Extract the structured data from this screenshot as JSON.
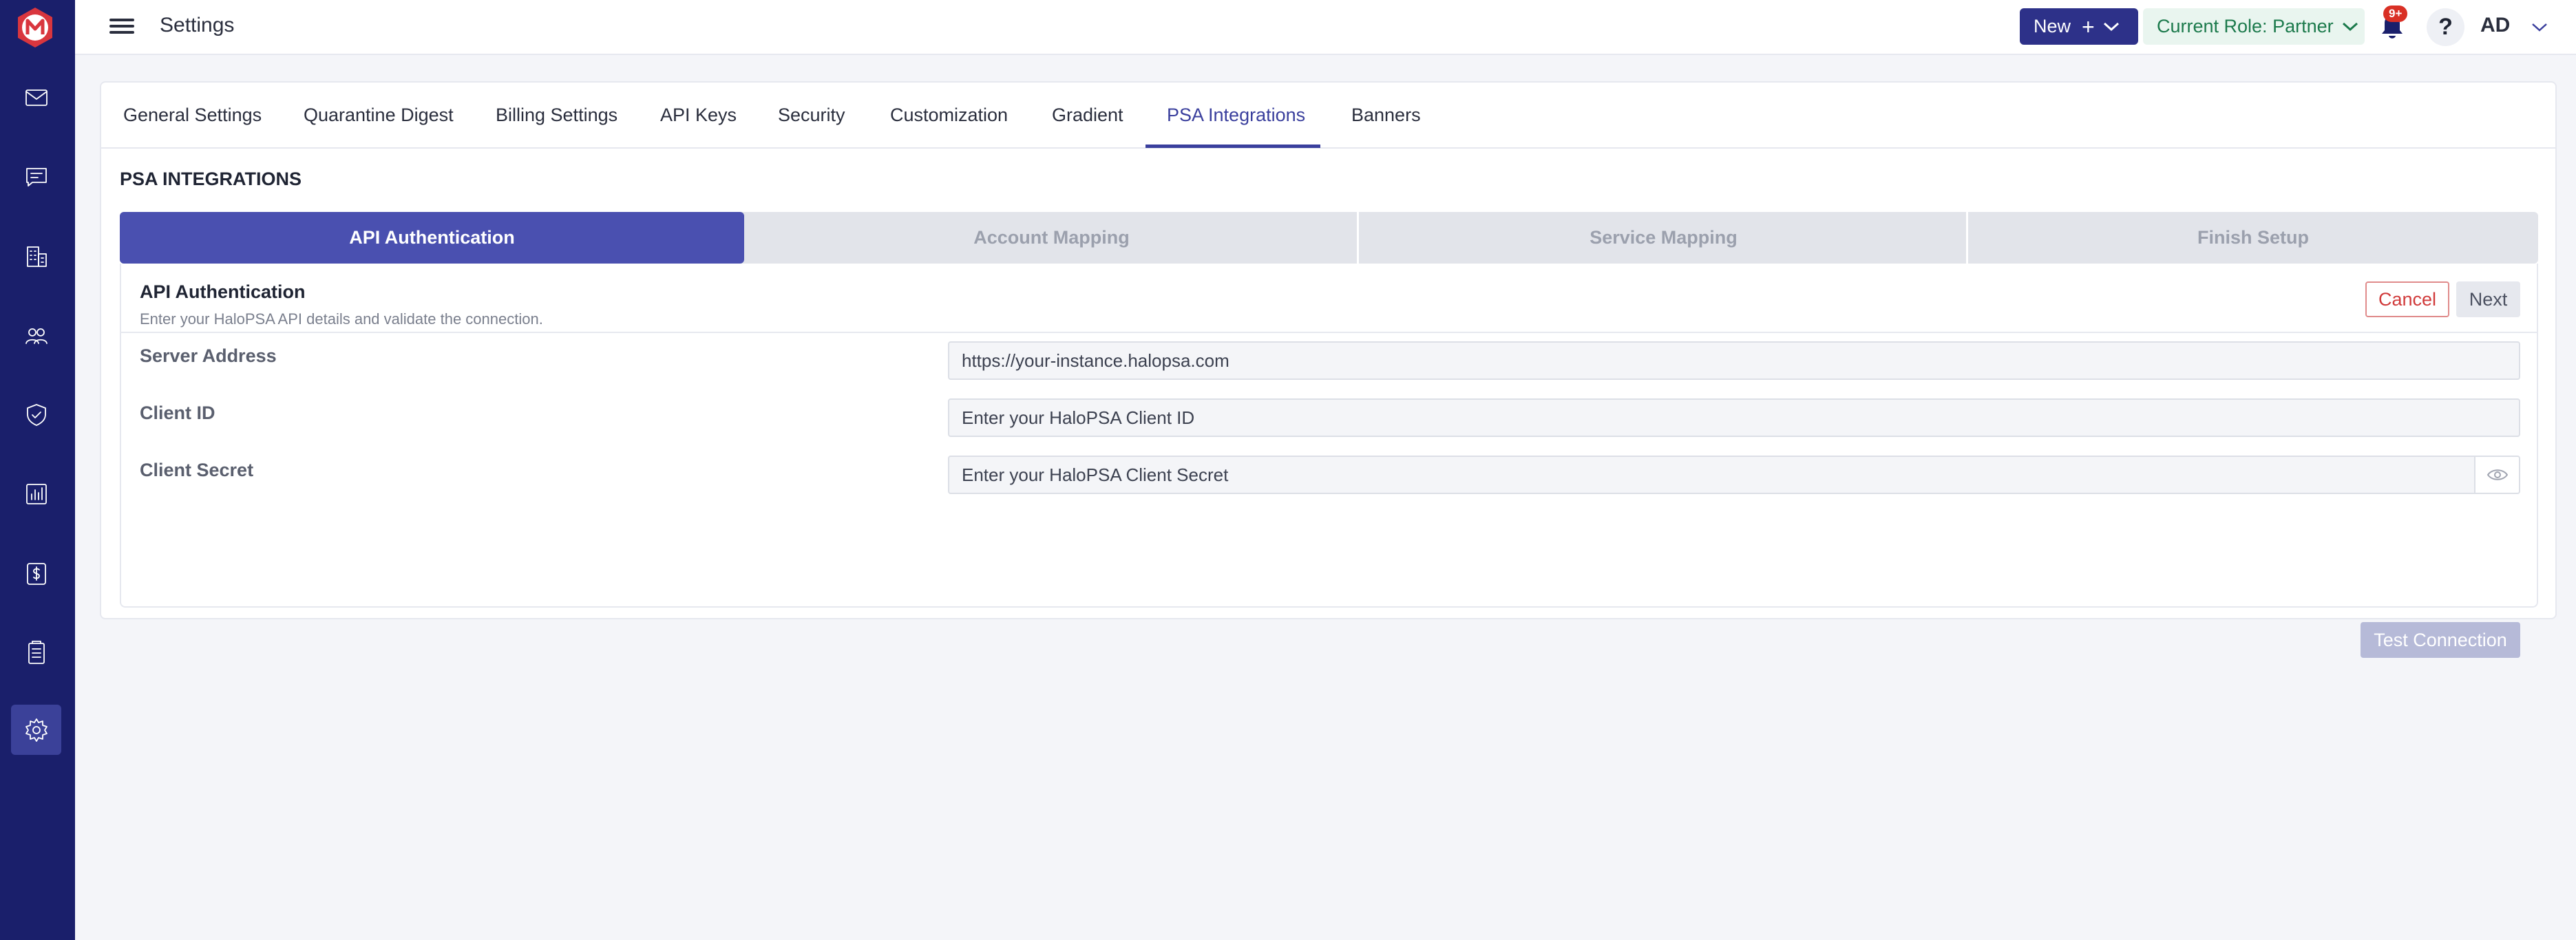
{
  "app": {
    "page_title": "Settings"
  },
  "sidebar": {
    "items": [
      {
        "icon": "mail-icon"
      },
      {
        "icon": "message-icon"
      },
      {
        "icon": "building-icon"
      },
      {
        "icon": "users-icon"
      },
      {
        "icon": "shield-icon"
      },
      {
        "icon": "chart-icon"
      },
      {
        "icon": "billing-icon"
      },
      {
        "icon": "document-icon"
      },
      {
        "icon": "gear-icon",
        "active": true
      }
    ]
  },
  "header": {
    "new_label": "New",
    "role_label": "Current Role: Partner",
    "notifications_badge": "9+",
    "help_label": "?",
    "avatar_initials": "AD"
  },
  "tabs": [
    {
      "label": "General Settings"
    },
    {
      "label": "Quarantine Digest"
    },
    {
      "label": "Billing Settings"
    },
    {
      "label": "API Keys"
    },
    {
      "label": "Security"
    },
    {
      "label": "Customization"
    },
    {
      "label": "Gradient"
    },
    {
      "label": "PSA Integrations",
      "active": true
    },
    {
      "label": "Banners"
    }
  ],
  "section_title": "PSA INTEGRATIONS",
  "steps": [
    {
      "label": "API Authentication",
      "active": true
    },
    {
      "label": "Account Mapping"
    },
    {
      "label": "Service Mapping"
    },
    {
      "label": "Finish Setup"
    }
  ],
  "panel": {
    "title": "API Authentication",
    "subtitle": "Enter your HaloPSA API details and validate the connection.",
    "cancel_label": "Cancel",
    "next_label": "Next",
    "fields": [
      {
        "label": "Server Address",
        "value": "https://your-instance.halopsa.com"
      },
      {
        "label": "Client ID",
        "placeholder": "Enter your HaloPSA Client ID"
      },
      {
        "label": "Client Secret",
        "placeholder": "Enter your HaloPSA Client Secret"
      }
    ],
    "test_label": "Test Connection"
  },
  "colors": {
    "sidebar_bg": "#1a1f6b",
    "accent": "#3a3f9d",
    "step_active": "#4a50b0",
    "role_text": "#1c7a4c",
    "cancel_red": "#d13b3b"
  }
}
